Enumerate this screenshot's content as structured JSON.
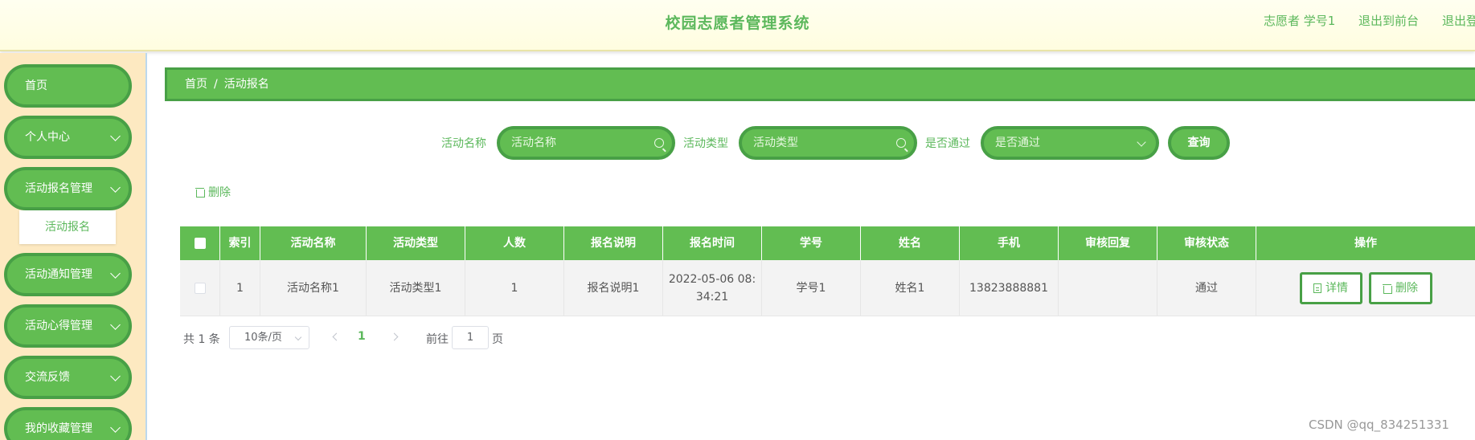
{
  "header": {
    "title": "校园志愿者管理系统",
    "user": "志愿者 学号1",
    "back_to_front": "退出到前台",
    "logout": "退出登"
  },
  "sidebar": {
    "items": [
      {
        "label": "首页",
        "has_arrow": false
      },
      {
        "label": "个人中心",
        "has_arrow": true
      },
      {
        "label": "活动报名管理",
        "has_arrow": true
      },
      {
        "label": "活动通知管理",
        "has_arrow": true
      },
      {
        "label": "活动心得管理",
        "has_arrow": true
      },
      {
        "label": "交流反馈",
        "has_arrow": true
      },
      {
        "label": "我的收藏管理",
        "has_arrow": true
      }
    ],
    "submenu": {
      "label": "活动报名"
    }
  },
  "breadcrumb": {
    "home": "首页",
    "separator": "/",
    "current": "活动报名"
  },
  "search": {
    "name_label": "活动名称",
    "name_placeholder": "活动名称",
    "type_label": "活动类型",
    "type_placeholder": "活动类型",
    "pass_label": "是否通过",
    "pass_placeholder": "是否通过",
    "query_button": "查询"
  },
  "toolbar": {
    "delete_label": "删除"
  },
  "table": {
    "headers": [
      "索引",
      "活动名称",
      "活动类型",
      "人数",
      "报名说明",
      "报名时间",
      "学号",
      "姓名",
      "手机",
      "审核回复",
      "审核状态",
      "操作"
    ],
    "rows": [
      {
        "index": "1",
        "activity_name": "活动名称1",
        "activity_type": "活动类型1",
        "count": "1",
        "description": "报名说明1",
        "time_line1": "2022-05-06 08:",
        "time_line2": "34:21",
        "student_id": "学号1",
        "name": "姓名1",
        "phone": "13823888881",
        "review_reply": "",
        "review_status": "通过",
        "detail_button": "详情",
        "delete_button": "删除"
      }
    ]
  },
  "pagination": {
    "total": "共 1 条",
    "page_size": "10条/页",
    "current_page": "1",
    "goto_label": "前往",
    "goto_value": "1",
    "page_suffix": "页"
  },
  "watermark": "CSDN @qq_834251331",
  "colors": {
    "accent": "#62bd52",
    "accent_border": "#48a046",
    "sidebar_bg": "#fde9c1",
    "header_bg": "#fffde0"
  }
}
